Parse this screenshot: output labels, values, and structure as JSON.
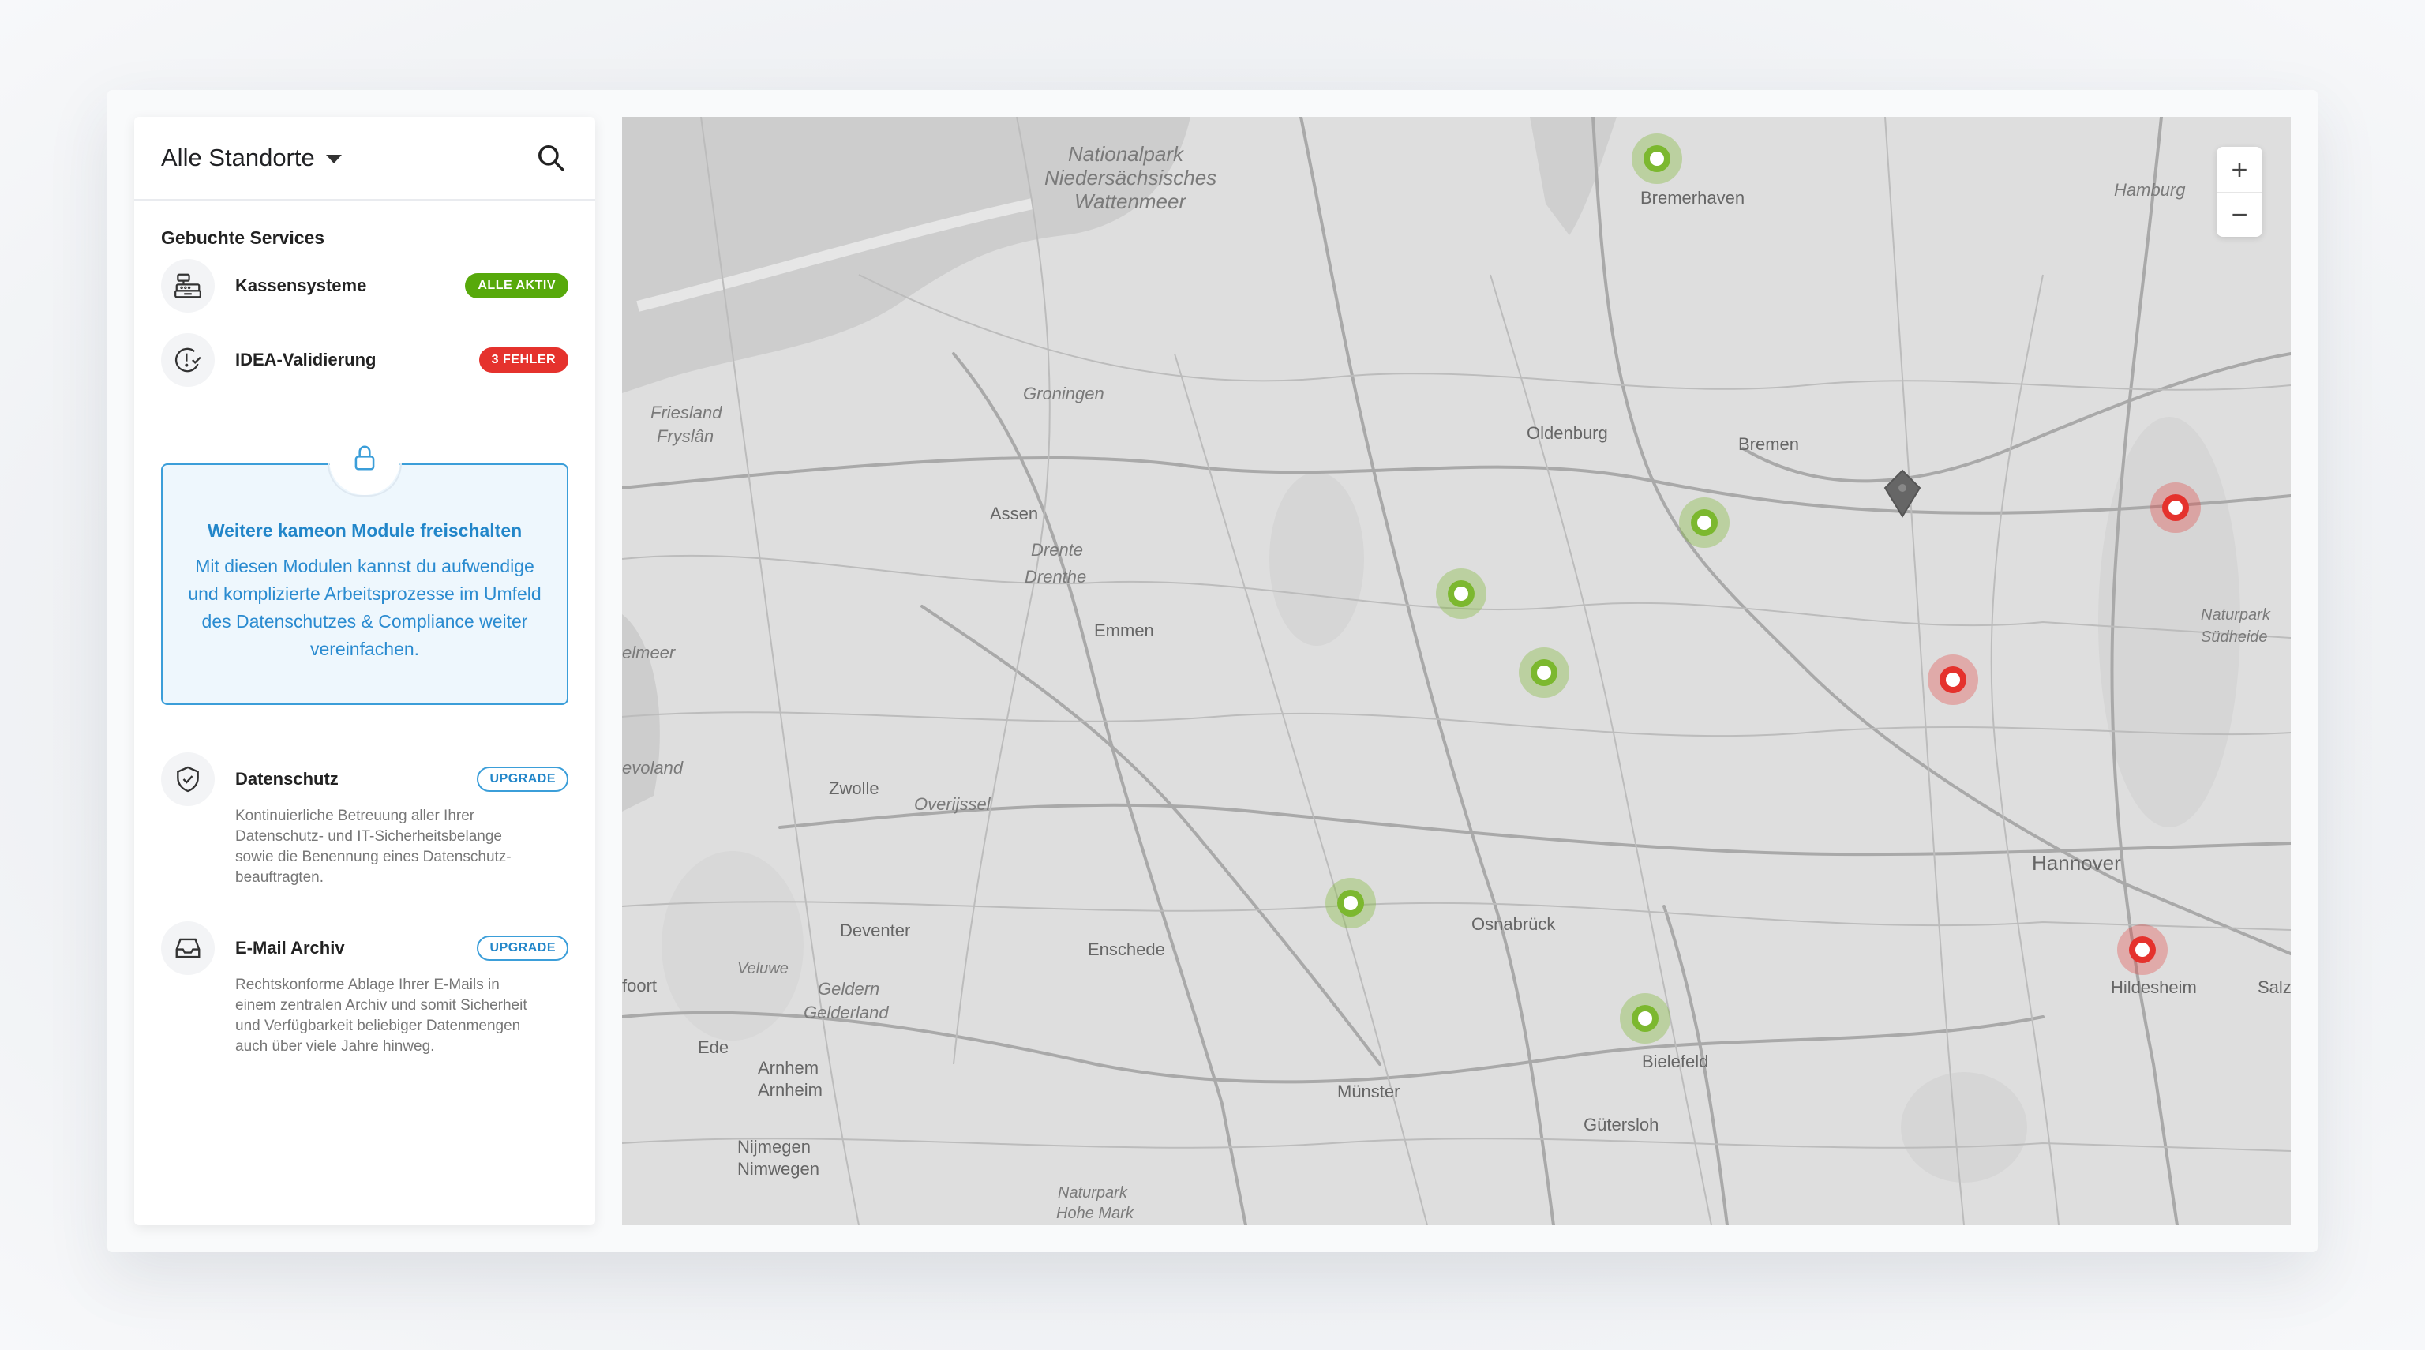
{
  "sidebar": {
    "location_selector": "Alle Standorte",
    "services_title": "Gebuchte Services",
    "services": [
      {
        "name": "Kassensysteme",
        "badge": "ALLE AKTIV",
        "badge_color": "#57a90b",
        "icon": "cash-register-icon"
      },
      {
        "name": "IDEA-Validierung",
        "badge": "3 FEHLER",
        "badge_color": "#e5322d",
        "icon": "validation-warning-icon"
      }
    ],
    "unlock": {
      "title": "Weitere kameon Module freischalten",
      "text": "Mit diesen Modulen kannst du aufwendige und komplizierte Arbeitsprozesse im Umfeld des Datenschutzes & Compliance weiter vereinfachen.",
      "icon": "lock-icon"
    },
    "modules": [
      {
        "name": "Datenschutz",
        "badge": "UPGRADE",
        "icon": "shield-check-icon",
        "description": "Kontinuierliche Betreuung aller Ihrer Datenschutz- und IT-Sicherheitsbelange sowie die Benennung eines Datenschutz-beauftragten."
      },
      {
        "name": "E-Mail Archiv",
        "badge": "UPGRADE",
        "icon": "inbox-archive-icon",
        "description": "Rechtskonforme Ablage Ihrer E-Mails in einem zentralen Archiv und somit Sicherheit und Verfügbarkeit beliebiger Datenmengen auch über viele Jahre hinweg."
      }
    ]
  },
  "map": {
    "zoom_in": "+",
    "zoom_out": "−",
    "colors": {
      "ok": "#7cb82f",
      "error": "#e5322d",
      "land": "#dedede",
      "water": "#c9c9c9"
    },
    "labels": {
      "nationalpark": "Nationalpark",
      "niedersachsisches": "Niedersächsisches",
      "wattenmeer": "Wattenmeer",
      "bremerhaven": "Bremerhaven",
      "hamburg": "Hamburg",
      "groningen": "Groningen",
      "friesland": "Friesland",
      "fryslan": "Fryslân",
      "oldenburg": "Oldenburg",
      "bremen": "Bremen",
      "assen": "Assen",
      "drente": "Drente",
      "drenthe": "Drenthe",
      "emmen": "Emmen",
      "ijsselmeer": "elmeer",
      "naturpark_sud": "Naturpark",
      "sudheide": "Südheide",
      "flevoland": "evoland",
      "zwolle": "Zwolle",
      "overijssel": "Overijssel",
      "hannover": "Hannover",
      "deventer": "Deventer",
      "enschede": "Enschede",
      "osnabruck": "Osnabrück",
      "apeldoorn": "foort",
      "veluwe": "Veluwe",
      "gelderland1": "Geldern",
      "gelderland2": "Gelderland",
      "hildesheim": "Hildesheim",
      "salz": "Salz",
      "ede": "Ede",
      "arnhem": "Arnhem",
      "arnheim": "Arnheim",
      "bielefeld": "Bielefeld",
      "munster": "Münster",
      "gutersloh": "Gütersloh",
      "nijmegen": "Nijmegen",
      "nimwegen": "Nimwegen",
      "naturpark2": "Naturpark",
      "hohe_mark": "Hohe Mark"
    }
  }
}
